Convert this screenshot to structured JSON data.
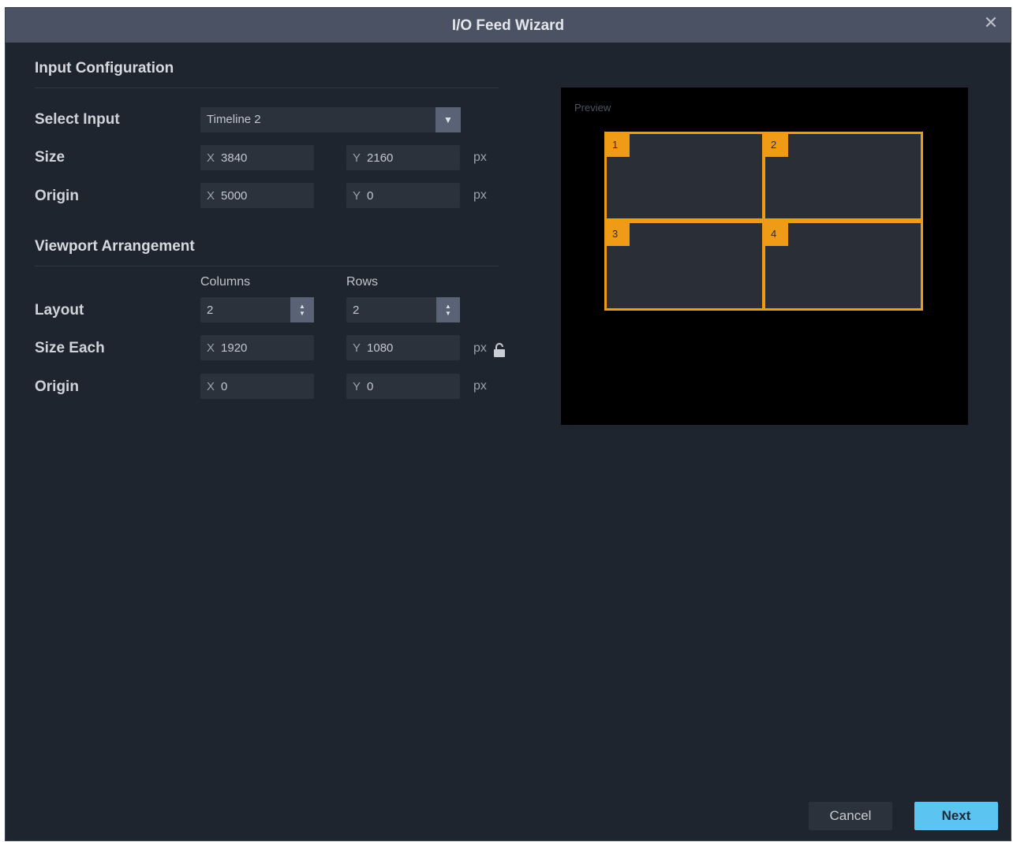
{
  "window": {
    "title": "I/O Feed Wizard"
  },
  "input_config": {
    "heading": "Input Configuration",
    "select_input": {
      "label": "Select Input",
      "value": "Timeline 2"
    },
    "size": {
      "label": "Size",
      "x_axis": "X",
      "x": "3840",
      "y_axis": "Y",
      "y": "2160",
      "unit": "px"
    },
    "origin": {
      "label": "Origin",
      "x_axis": "X",
      "x": "5000",
      "y_axis": "Y",
      "y": "0",
      "unit": "px"
    }
  },
  "viewport": {
    "heading": "Viewport Arrangement",
    "columns_label": "Columns",
    "rows_label": "Rows",
    "layout": {
      "label": "Layout",
      "columns": "2",
      "rows": "2"
    },
    "size_each": {
      "label": "Size Each",
      "x_axis": "X",
      "x": "1920",
      "y_axis": "Y",
      "y": "1080",
      "unit": "px"
    },
    "origin": {
      "label": "Origin",
      "x_axis": "X",
      "x": "0",
      "y_axis": "Y",
      "y": "0",
      "unit": "px"
    }
  },
  "preview": {
    "label": "Preview",
    "viewports": [
      "1",
      "2",
      "3",
      "4"
    ],
    "accent_color": "#ef9b16"
  },
  "footer": {
    "cancel_label": "Cancel",
    "next_label": "Next"
  },
  "icons": {
    "close": "close-icon",
    "dropdown": "chevron-down-icon",
    "stepper": "stepper-arrows-icon",
    "lock": "unlock-icon"
  }
}
